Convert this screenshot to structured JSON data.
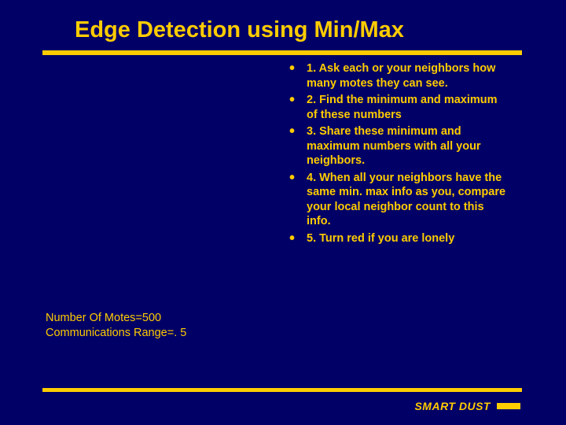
{
  "title": "Edge Detection using Min/Max",
  "bullets": [
    "1. Ask each or your neighbors how many motes they can see.",
    "2. Find the minimum and maximum of these numbers",
    "3. Share these minimum and maximum numbers with all your neighbors.",
    "4. When all your neighbors have the same min. max info as you, compare your local neighbor count to this info.",
    "5. Turn red if you are lonely"
  ],
  "caption": {
    "line1": "Number Of Motes=500",
    "line2": "Communications Range=. 5"
  },
  "footer": {
    "brand": "SMART DUST"
  }
}
